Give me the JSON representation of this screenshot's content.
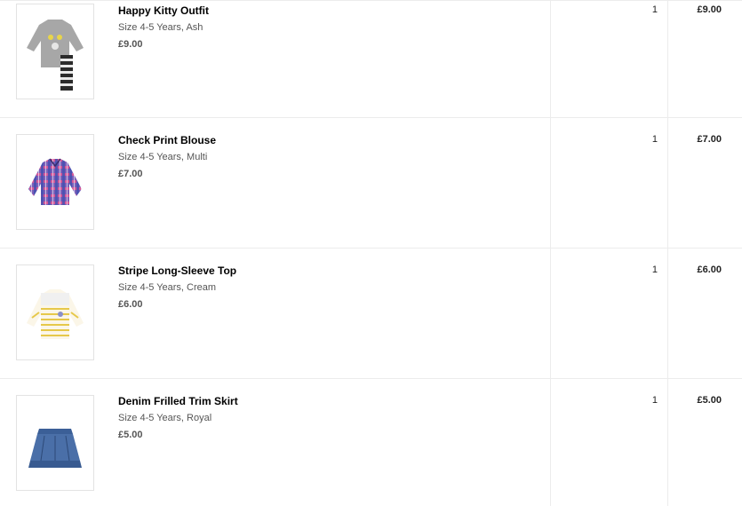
{
  "items": [
    {
      "name": "Happy Kitty Outfit",
      "variant": "Size 4-5 Years, Ash",
      "price": "£9.00",
      "quantity": "1",
      "total": "£9.00",
      "image_icon": "kitty-outfit-image"
    },
    {
      "name": "Check Print Blouse",
      "variant": "Size 4-5 Years, Multi",
      "price": "£7.00",
      "quantity": "1",
      "total": "£7.00",
      "image_icon": "check-blouse-image"
    },
    {
      "name": "Stripe Long-Sleeve Top",
      "variant": "Size 4-5 Years, Cream",
      "price": "£6.00",
      "quantity": "1",
      "total": "£6.00",
      "image_icon": "stripe-top-image"
    },
    {
      "name": "Denim Frilled Trim Skirt",
      "variant": "Size 4-5 Years, Royal",
      "price": "£5.00",
      "quantity": "1",
      "total": "£5.00",
      "image_icon": "denim-skirt-image"
    }
  ],
  "colors": {
    "divider": "#ececec",
    "muted_text": "#555555"
  }
}
